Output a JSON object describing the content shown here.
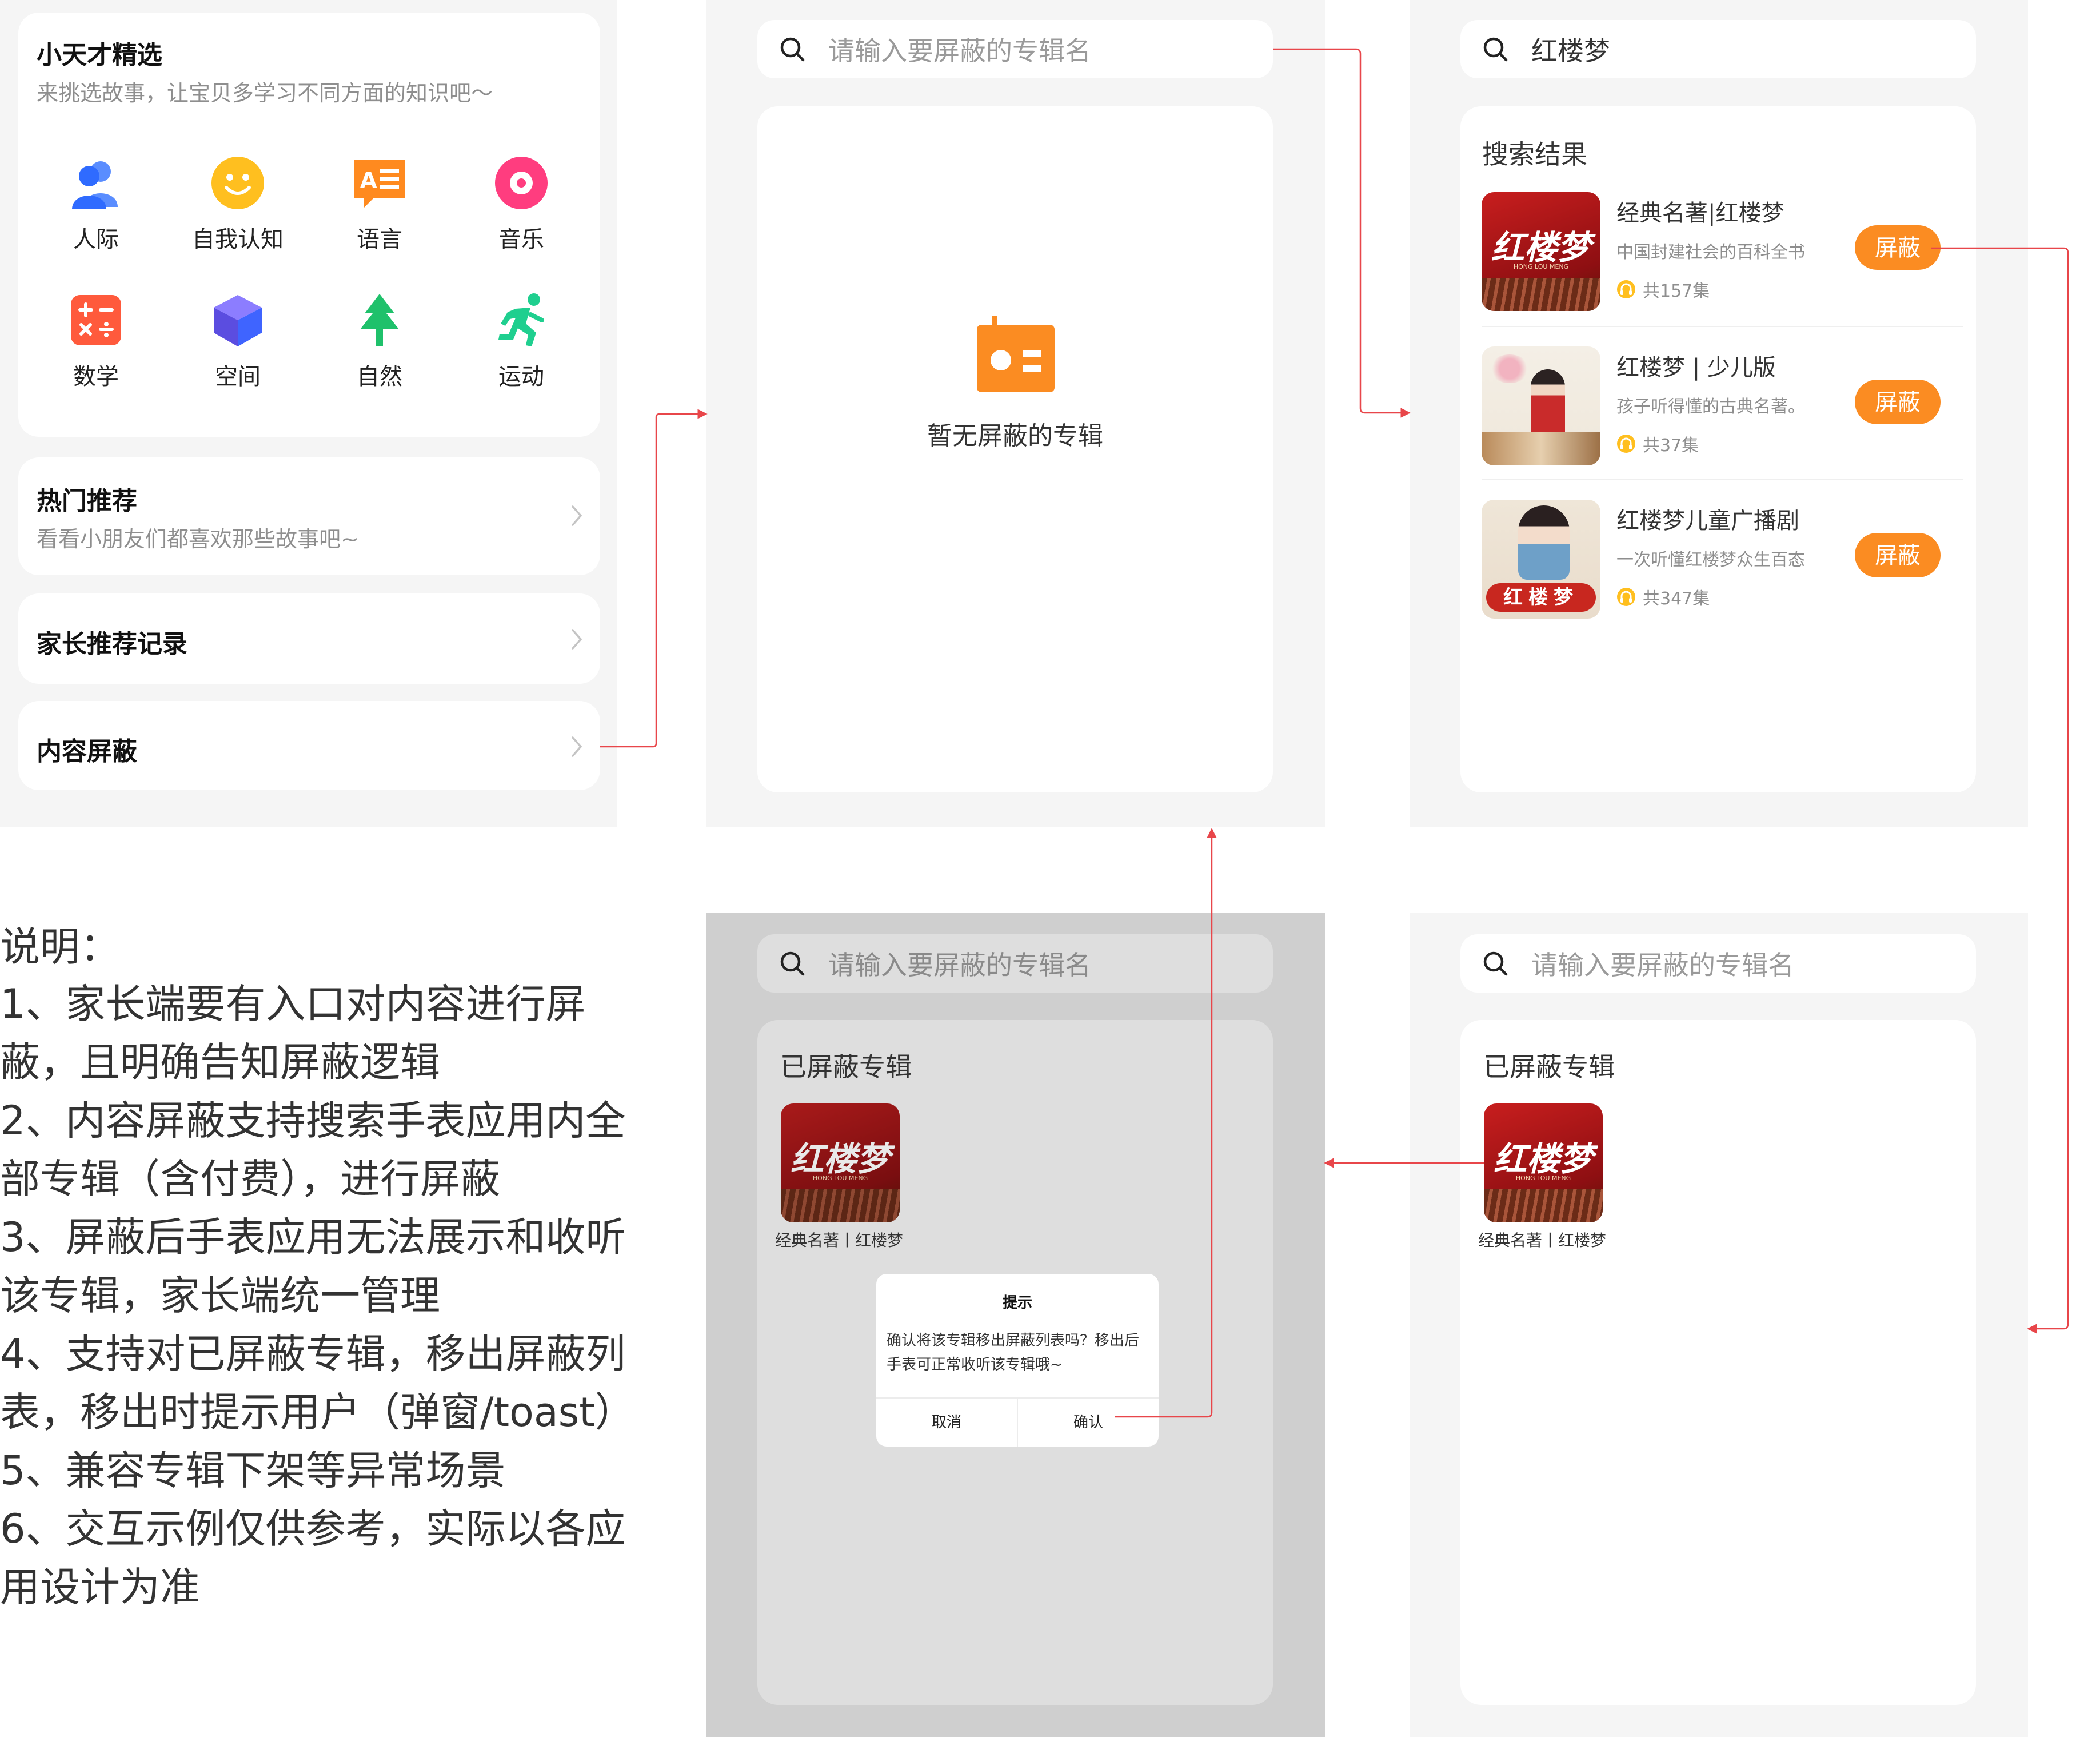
{
  "panel1": {
    "featured": {
      "title": "小天才精选",
      "subtitle": "来挑选故事，让宝贝多学习不同方面的知识吧～",
      "categories": [
        {
          "label": "人际",
          "icon": "people-icon"
        },
        {
          "label": "自我认知",
          "icon": "smiley-face-icon"
        },
        {
          "label": "语言",
          "icon": "language-chat-icon"
        },
        {
          "label": "音乐",
          "icon": "music-disc-icon"
        },
        {
          "label": "数学",
          "icon": "math-calculator-icon"
        },
        {
          "label": "空间",
          "icon": "cube-icon"
        },
        {
          "label": "自然",
          "icon": "tree-icon"
        },
        {
          "label": "运动",
          "icon": "running-person-icon"
        }
      ]
    },
    "hot": {
      "title": "热门推荐",
      "subtitle": "看看小朋友们都喜欢那些故事吧~"
    },
    "parent_records": {
      "title": "家长推荐记录"
    },
    "content_block": {
      "title": "内容屏蔽"
    }
  },
  "panel2": {
    "search_placeholder": "请输入要屏蔽的专辑名",
    "empty_text": "暂无屏蔽的专辑"
  },
  "panel3": {
    "search_value": "红楼梦",
    "results_label": "搜索结果",
    "results": [
      {
        "title": "经典名著|红楼梦",
        "desc": "中国封建社会的百科全书",
        "count": "共157集",
        "button": "屏蔽"
      },
      {
        "title": "红楼梦 | 少儿版",
        "desc": "孩子听得懂的古典名著。",
        "count": "共37集",
        "button": "屏蔽"
      },
      {
        "title": "红楼梦儿童广播剧",
        "desc": "一次听懂红楼梦众生百态",
        "count": "共347集",
        "button": "屏蔽"
      }
    ]
  },
  "panel4": {
    "search_placeholder": "请输入要屏蔽的专辑名",
    "section_label": "已屏蔽专辑",
    "album_caption": "经典名著丨红楼梦",
    "dialog": {
      "title": "提示",
      "message": "确认将该专辑移出屏蔽列表吗？移出后手表可正常收听该专辑哦~",
      "cancel": "取消",
      "confirm": "确认"
    }
  },
  "panel5": {
    "search_placeholder": "请输入要屏蔽的专辑名",
    "section_label": "已屏蔽专辑",
    "album_caption": "经典名著丨红楼梦"
  },
  "notes": {
    "heading": "说明：",
    "lines": [
      "1、家长端要有入口对内容进行屏",
      "蔽，且明确告知屏蔽逻辑",
      "2、内容屏蔽支持搜索手表应用内全",
      "部专辑（含付费），进行屏蔽",
      "3、屏蔽后手表应用无法展示和收听",
      "该专辑，家长端统一管理",
      "4、支持对已屏蔽专辑，移出屏蔽列",
      "表，移出时提示用户（弹窗/toast）",
      "5、兼容专辑下架等异常场景",
      "6、交互示例仅供参考，实际以各应",
      "用设计为准"
    ]
  },
  "cover_texts": {
    "album1": "红楼梦",
    "album1_sub": "HONG LOU MENG",
    "album3_seal": "红楼梦"
  },
  "colors": {
    "accent_orange": "#fb8c22",
    "connector_red": "#e8464a",
    "panel_bg": "#f5f5f5",
    "overlay_bg": "#cfcfcf"
  }
}
